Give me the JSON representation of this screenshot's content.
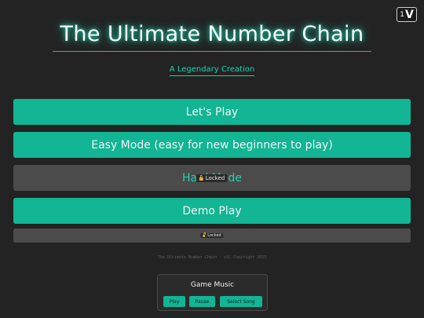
{
  "version_badge": {
    "number": "1",
    "glyph": "V"
  },
  "header": {
    "title": "The Ultimate Number Chain",
    "subtitle": "A Legendary Creation"
  },
  "menu": {
    "play_label": "Let's Play",
    "easy_label": "Easy Mode (easy for new beginners to play)",
    "hard_label": "Hard Mode",
    "hard_lock_label": "Locked",
    "demo_label": "Demo Play",
    "extra_lock_label": "Locked"
  },
  "footer": {
    "copyright": "The Ultimate Number Chain - v1C Copyright 2025"
  },
  "music": {
    "title": "Game Music",
    "play_label": "Play",
    "pause_label": "Pause",
    "select_label": "Select Song"
  },
  "colors": {
    "accent": "#12b594",
    "background": "#232323",
    "locked": "#4b4b4b"
  }
}
